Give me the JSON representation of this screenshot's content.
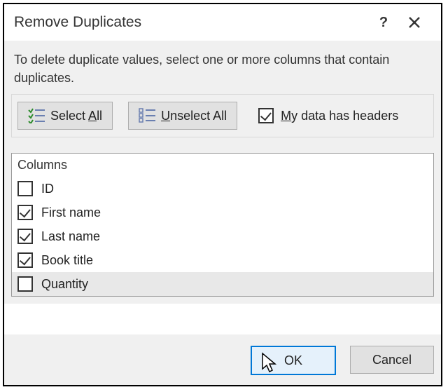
{
  "title": "Remove Duplicates",
  "instruction": "To delete duplicate values, select one or more columns that contain duplicates.",
  "toolbar": {
    "select_all_pre": "Select ",
    "select_all_u": "A",
    "select_all_post": "ll",
    "unselect_all_pre": "",
    "unselect_all_u": "U",
    "unselect_all_post": "nselect All",
    "headers_pre": "",
    "headers_u": "M",
    "headers_post": "y data has headers",
    "headers_checked": true
  },
  "columns": {
    "header": "Columns",
    "items": [
      {
        "label": "ID",
        "checked": false,
        "highlight": false
      },
      {
        "label": "First name",
        "checked": true,
        "highlight": false
      },
      {
        "label": "Last name",
        "checked": true,
        "highlight": false
      },
      {
        "label": "Book title",
        "checked": true,
        "highlight": false
      },
      {
        "label": "Quantity",
        "checked": false,
        "highlight": true
      }
    ]
  },
  "buttons": {
    "ok": "OK",
    "cancel": "Cancel"
  }
}
